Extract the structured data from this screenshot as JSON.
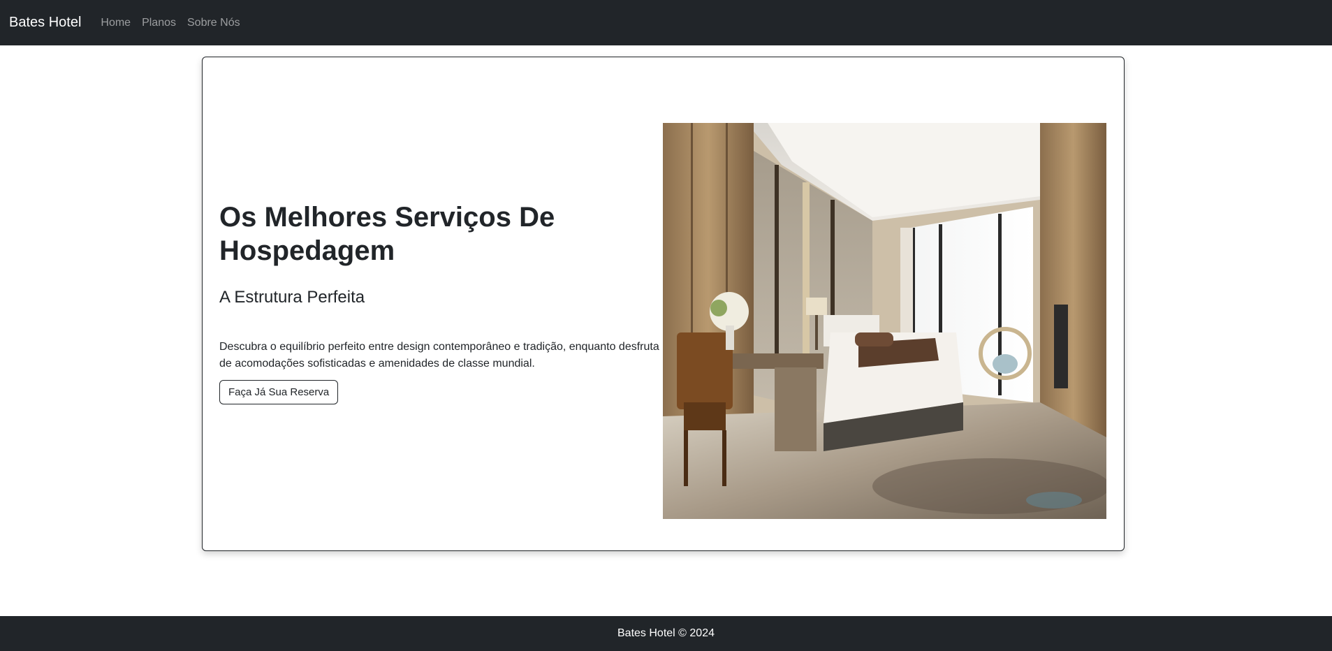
{
  "navbar": {
    "brand": "Bates Hotel",
    "links": [
      "Home",
      "Planos",
      "Sobre Nós"
    ]
  },
  "hero": {
    "title_line1": "Os Melhores Serviços De",
    "title_line2": "Hospedagem",
    "subtitle": "A Estrutura Perfeita",
    "description_line1": "Descubra o equilíbrio perfeito entre design contemporâneo e tradição, enquanto desfruta",
    "description_line2": "de acomodações sofisticadas e amenidades de classe mundial.",
    "cta_label": "Faça Já Sua Reserva",
    "image": "hotel-room-photo"
  },
  "footer": {
    "text": "Bates Hotel © 2024"
  },
  "colors": {
    "navbar_bg": "#212529",
    "footer_bg": "#212529",
    "text": "#212529",
    "nav_link": "rgba(255,255,255,0.55)"
  }
}
